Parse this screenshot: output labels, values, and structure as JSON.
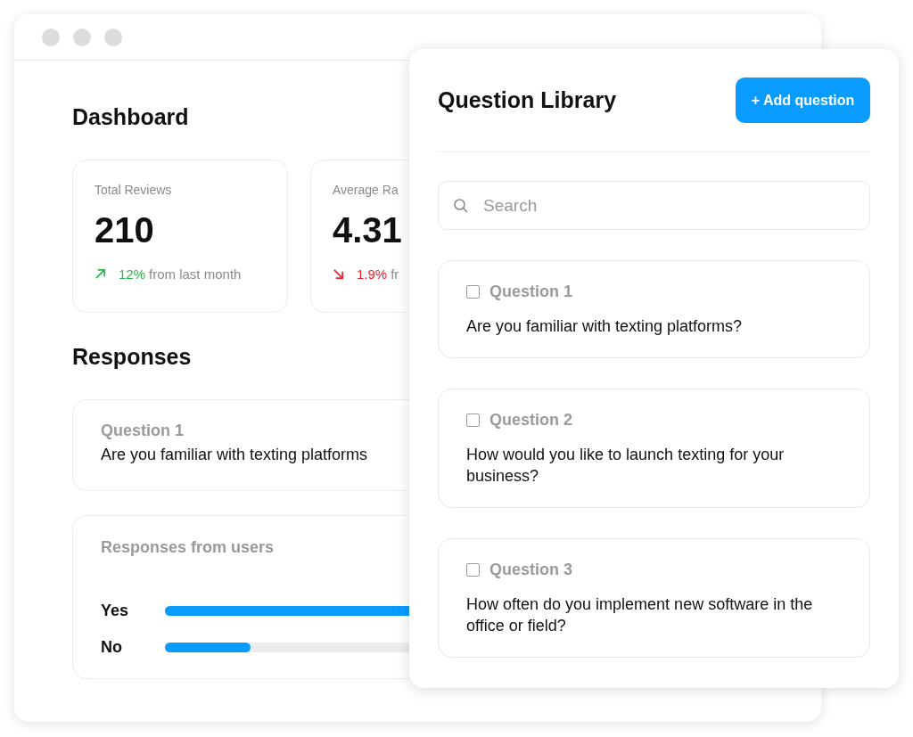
{
  "dashboard": {
    "title": "Dashboard",
    "stats": [
      {
        "label": "Total Reviews",
        "value": "210",
        "kind": "up",
        "change": "12%",
        "note": "from last month"
      },
      {
        "label": "Average Ra",
        "value": "4.31",
        "kind": "down",
        "change": "1.9%",
        "note": "fr"
      }
    ],
    "responses": {
      "title": "Responses",
      "question": {
        "label": "Question 1",
        "text": "Are you familiar with texting platforms"
      },
      "chart": {
        "title": "Responses from users",
        "bars": [
          {
            "label": "Yes",
            "level": 0.75
          },
          {
            "label": "No",
            "level": 0.15
          }
        ]
      }
    }
  },
  "question_library": {
    "title": "Question Library",
    "add_button": "+ Add question",
    "search": {
      "placeholder": "Search"
    },
    "questions": [
      {
        "label": "Question 1",
        "text": "Are you familiar with texting platforms?",
        "checked": false
      },
      {
        "label": "Question 2",
        "text": "How would you like to launch texting for your business?",
        "checked": false
      },
      {
        "label": "Question 3",
        "text": "How often do you implement new software in the office or field?",
        "checked": false
      }
    ]
  }
}
